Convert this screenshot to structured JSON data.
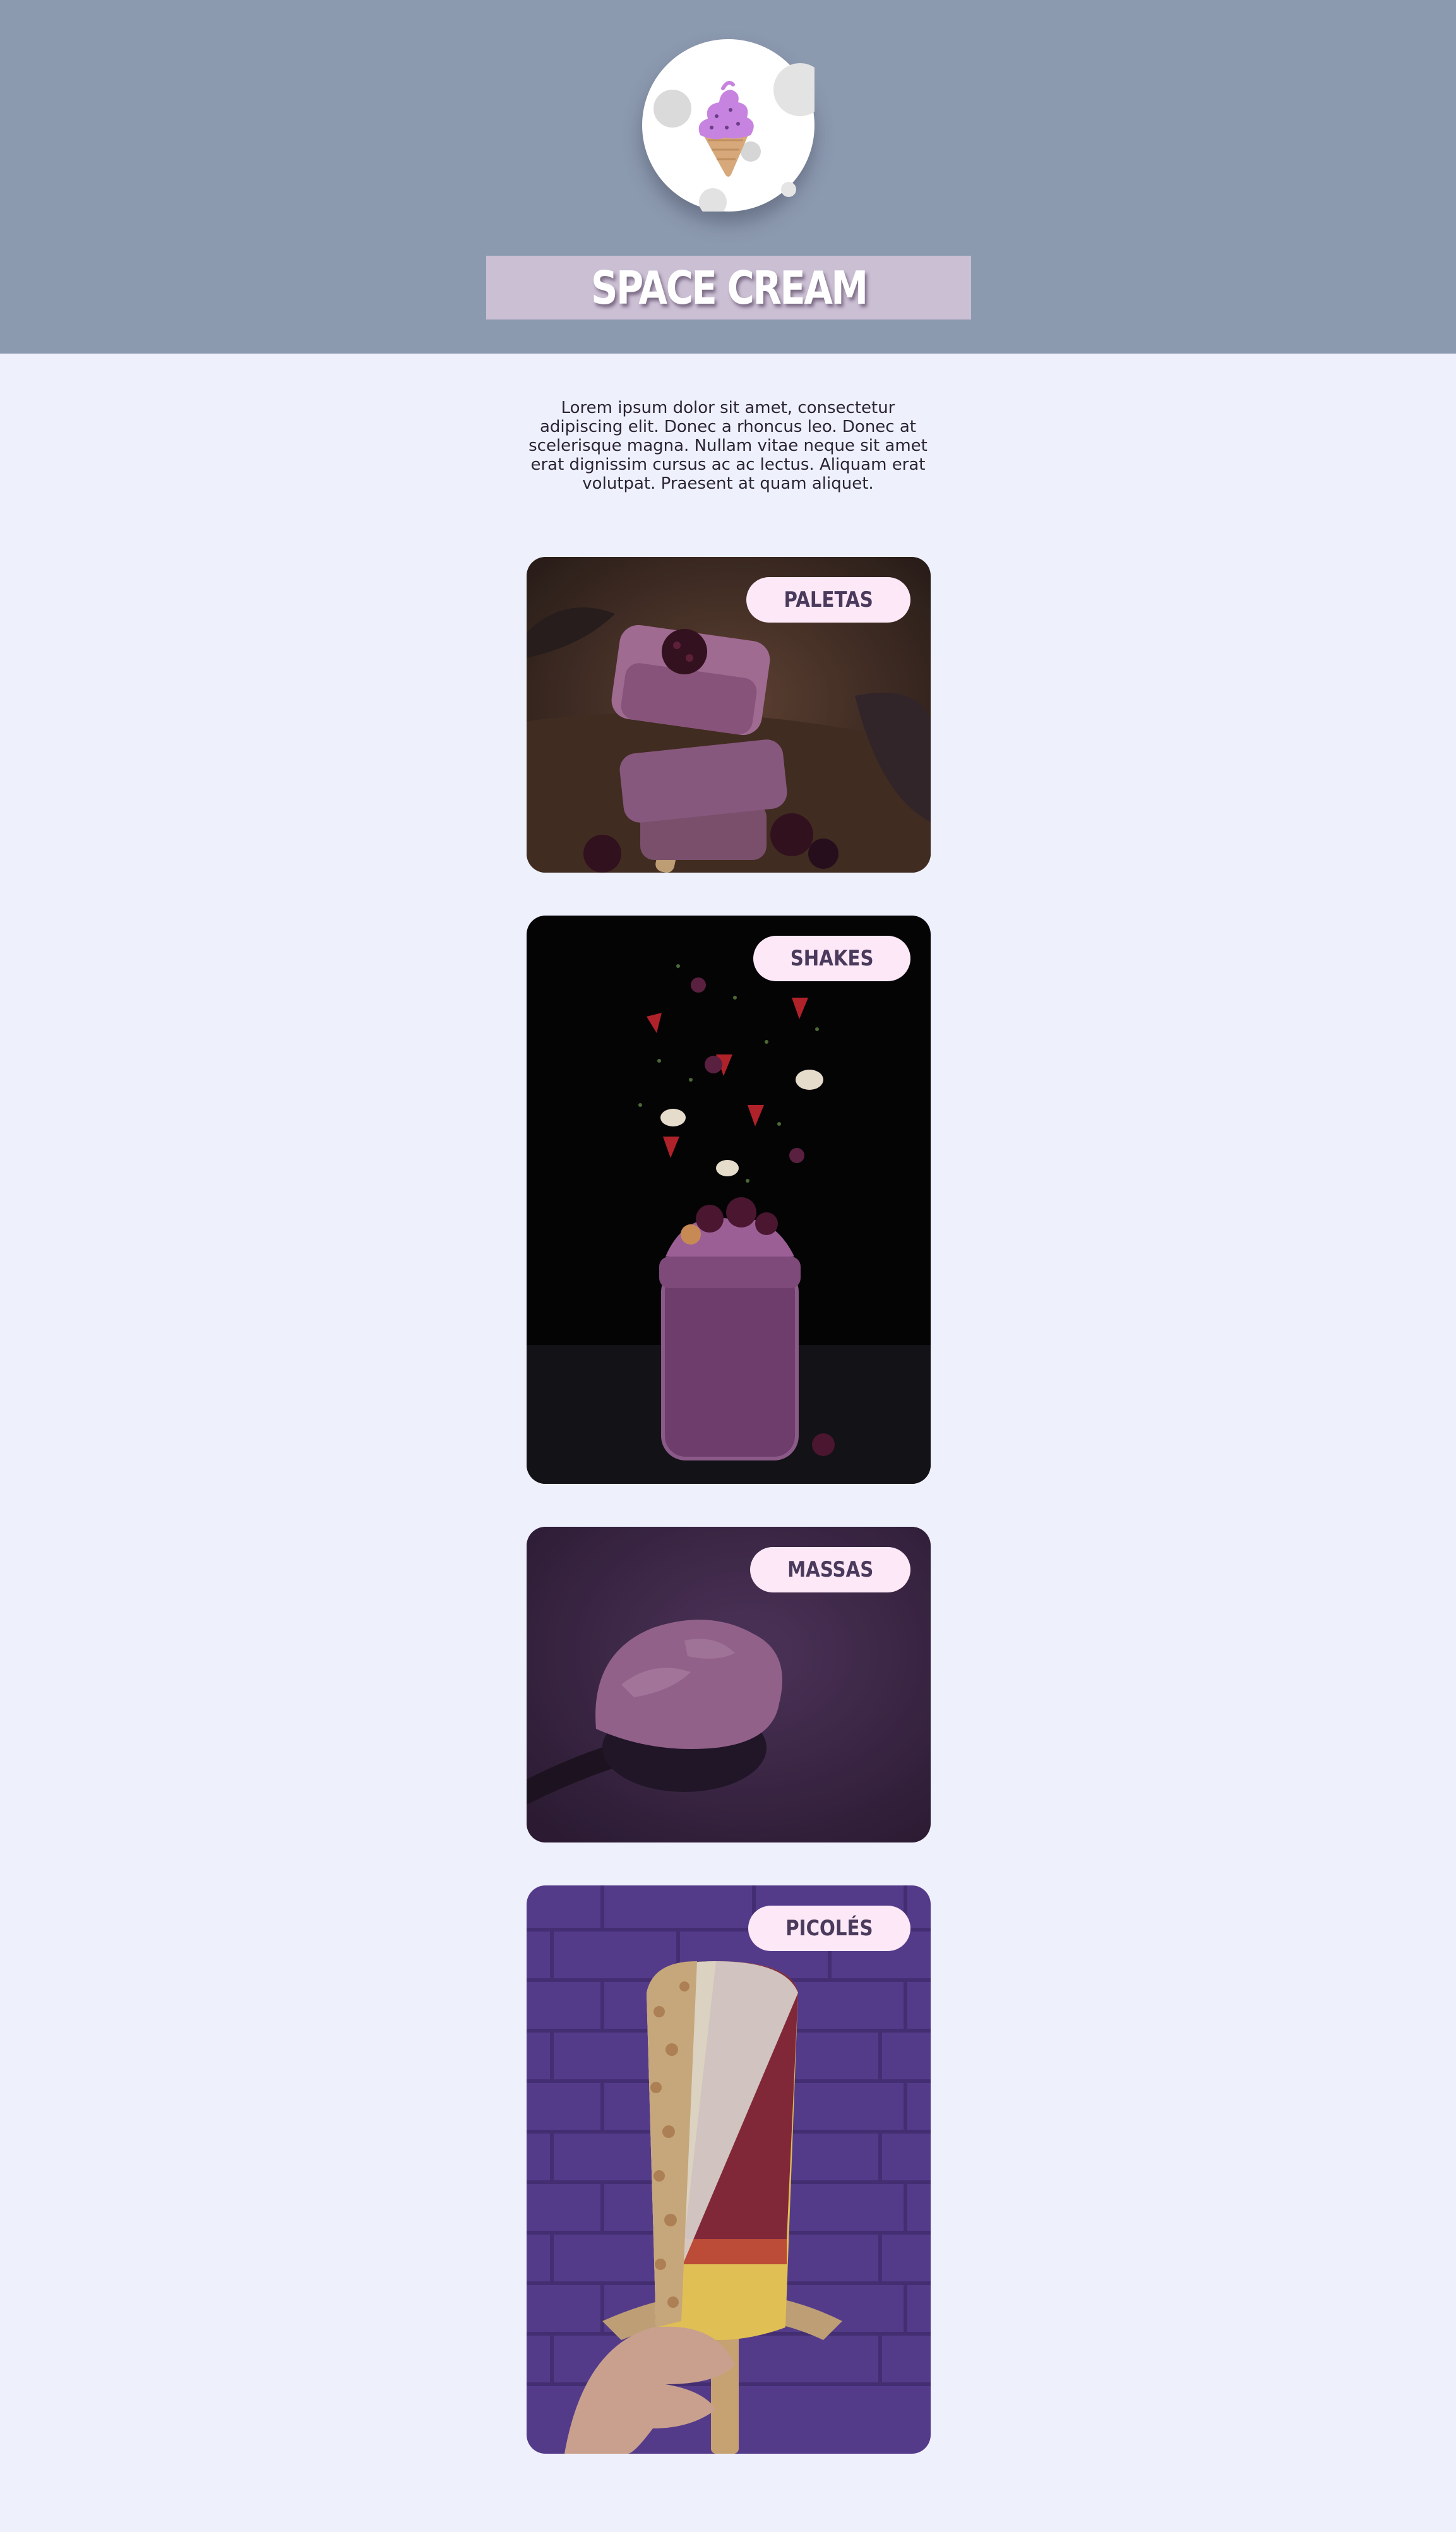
{
  "header": {
    "brand_title": "SPACE CREAM",
    "logo_icon": "ice-cream-cone-icon",
    "background_color": "#8c9ab0",
    "title_bar_color": "#cbbfd4"
  },
  "intro": {
    "text": "Lorem ipsum dolor sit amet, consectetur adipiscing elit. Donec a rhoncus leo. Donec at scelerisque magna. Nullam vitae neque sit amet erat dignissim cursus ac ac lectus. Aliquam erat volutpat. Praesent at quam aliquet."
  },
  "categories": [
    {
      "label": "PALETAS",
      "image": "stacked-berry-popsicles"
    },
    {
      "label": "SHAKES",
      "image": "berry-shake-jar-with-flying-fruit"
    },
    {
      "label": "MASSAS",
      "image": "scoop-of-purple-ice-cream"
    },
    {
      "label": "PICOLÉS",
      "image": "nut-covered-popsicle-in-hand"
    }
  ],
  "colors": {
    "page_background": "#eef0fc",
    "badge_background": "#fde8f7",
    "badge_text": "#4a3a5c"
  }
}
